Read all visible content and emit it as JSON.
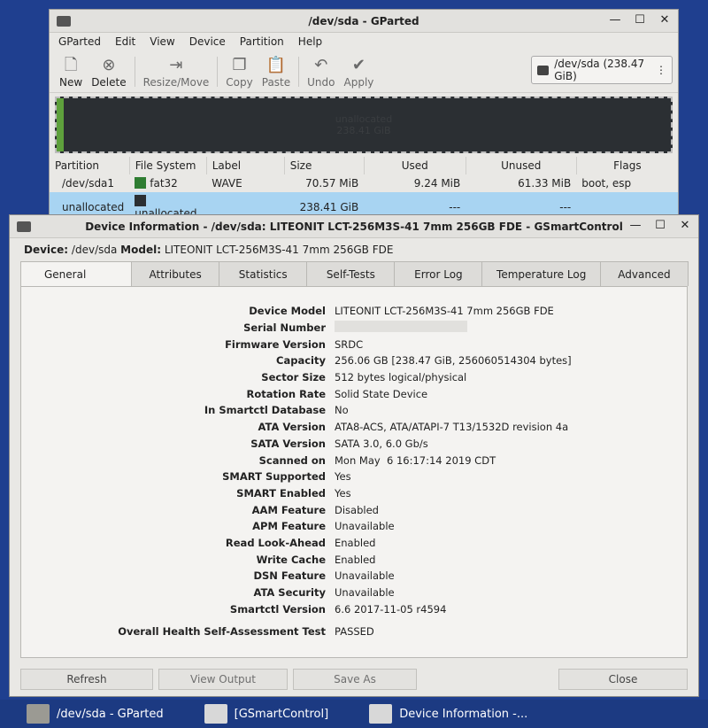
{
  "gparted": {
    "title": "/dev/sda - GParted",
    "menu": [
      "GParted",
      "Edit",
      "View",
      "Device",
      "Partition",
      "Help"
    ],
    "toolbar": [
      {
        "label": "New",
        "icon": "new-icon"
      },
      {
        "label": "Delete",
        "icon": "delete-icon"
      },
      {
        "label": "Resize/Move",
        "icon": "resize-move-icon"
      },
      {
        "label": "Copy",
        "icon": "copy-icon"
      },
      {
        "label": "Paste",
        "icon": "paste-icon"
      },
      {
        "label": "Undo",
        "icon": "undo-icon"
      },
      {
        "label": "Apply",
        "icon": "apply-icon"
      }
    ],
    "device_selector": "/dev/sda  (238.47 GiB)",
    "map_label_1": "unallocated",
    "map_label_2": "238.41 GiB",
    "columns": [
      "Partition",
      "File System",
      "Label",
      "Size",
      "Used",
      "Unused",
      "Flags"
    ],
    "rows": [
      {
        "partition": "/dev/sda1",
        "fs": "fat32",
        "fs_color": "#2f7d32",
        "label": "WAVE",
        "size": "70.57 MiB",
        "used": "9.24 MiB",
        "unused": "61.33 MiB",
        "flags": "boot, esp"
      },
      {
        "partition": "unallocated",
        "fs": "unallocated",
        "fs_color": "#2b2f33",
        "label": "",
        "size": "238.41 GiB",
        "used": "---",
        "unused": "---",
        "flags": ""
      }
    ]
  },
  "smart": {
    "title": "Device Information - /dev/sda: LITEONIT LCT-256M3S-41 7mm 256GB FDE - GSmartControl",
    "device_label": "Device:",
    "device_value": "/dev/sda",
    "model_label": "Model:",
    "model_value": "LITEONIT LCT-256M3S-41 7mm 256GB FDE",
    "tabs": [
      "General",
      "Attributes",
      "Statistics",
      "Self-Tests",
      "Error Log",
      "Temperature Log",
      "Advanced"
    ],
    "props": [
      {
        "k": "Device Model",
        "v": "LITEONIT LCT-256M3S-41 7mm 256GB FDE"
      },
      {
        "k": "Serial Number",
        "v": ""
      },
      {
        "k": "Firmware Version",
        "v": "SRDC"
      },
      {
        "k": "Capacity",
        "v": "256.06 GB [238.47 GiB, 256060514304 bytes]"
      },
      {
        "k": "Sector Size",
        "v": "512 bytes logical/physical"
      },
      {
        "k": "Rotation Rate",
        "v": "Solid State Device"
      },
      {
        "k": "In Smartctl Database",
        "v": "No"
      },
      {
        "k": "ATA Version",
        "v": "ATA8-ACS, ATA/ATAPI-7 T13/1532D revision 4a"
      },
      {
        "k": "SATA Version",
        "v": "SATA 3.0, 6.0 Gb/s"
      },
      {
        "k": "Scanned on",
        "v": "Mon May  6 16:17:14 2019 CDT"
      },
      {
        "k": "SMART Supported",
        "v": "Yes"
      },
      {
        "k": "SMART Enabled",
        "v": "Yes"
      },
      {
        "k": "AAM Feature",
        "v": "Disabled"
      },
      {
        "k": "APM Feature",
        "v": "Unavailable"
      },
      {
        "k": "Read Look-Ahead",
        "v": "Enabled"
      },
      {
        "k": "Write Cache",
        "v": "Enabled"
      },
      {
        "k": "DSN Feature",
        "v": "Unavailable"
      },
      {
        "k": "ATA Security",
        "v": "Unavailable"
      },
      {
        "k": "Smartctl Version",
        "v": "6.6 2017-11-05 r4594"
      }
    ],
    "health_label": "Overall Health Self-Assessment Test",
    "health_value": "PASSED",
    "buttons": {
      "refresh": "Refresh",
      "view_output": "View Output",
      "save_as": "Save As",
      "close": "Close"
    }
  },
  "taskbar": [
    {
      "label": "/dev/sda - GParted"
    },
    {
      "label": "[GSmartControl]"
    },
    {
      "label": "Device Information -..."
    }
  ]
}
